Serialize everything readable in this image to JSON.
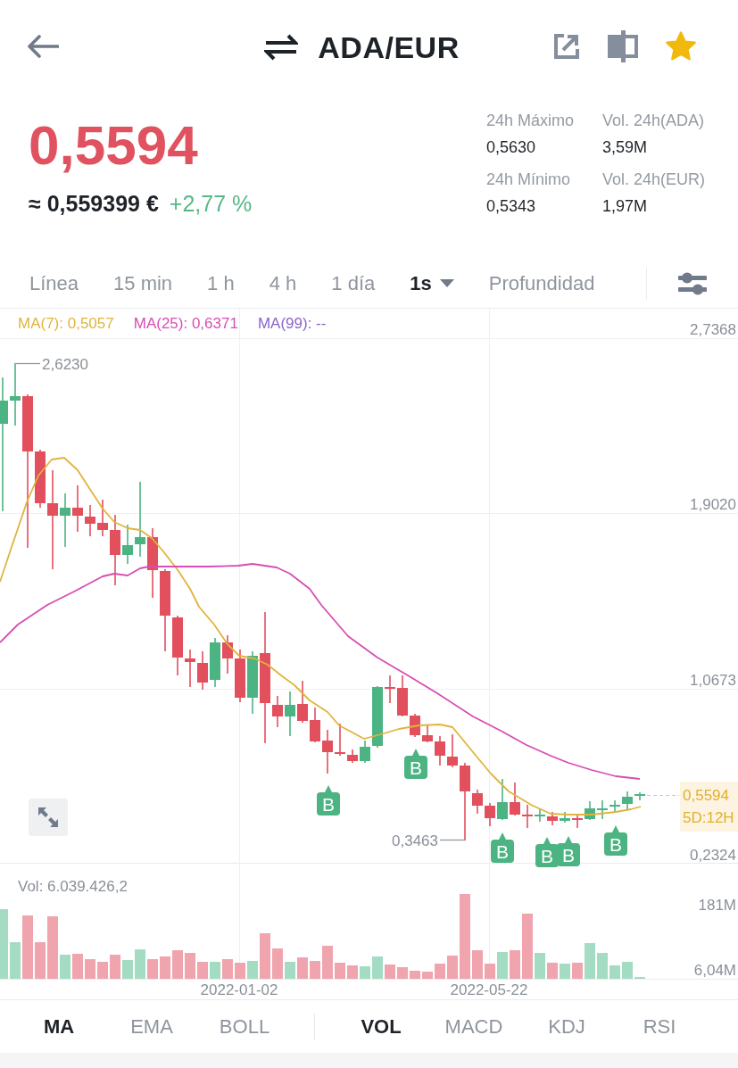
{
  "header": {
    "title": "ADA/EUR",
    "favorite": true
  },
  "price": {
    "value": "0,5594",
    "rising": false,
    "fiat": "≈ 0,559399 €",
    "change": "+2,77 %",
    "change_rising": true
  },
  "stats": [
    {
      "label": "24h Máximo",
      "value": "0,5630"
    },
    {
      "label": "Vol. 24h(ADA)",
      "value": "3,59M"
    },
    {
      "label": "24h Mínimo",
      "value": "0,5343"
    },
    {
      "label": "Vol. 24h(EUR)",
      "value": "1,97M"
    }
  ],
  "intervals": [
    {
      "label": "Línea",
      "kind": "option",
      "selected": false
    },
    {
      "label": "15 min",
      "kind": "option",
      "selected": false
    },
    {
      "label": "1 h",
      "kind": "option",
      "selected": false
    },
    {
      "label": "4 h",
      "kind": "option",
      "selected": false
    },
    {
      "label": "1 día",
      "kind": "option",
      "selected": false
    },
    {
      "label": "1s",
      "kind": "menu",
      "selected": true
    },
    {
      "label": "Profundidad",
      "kind": "option",
      "selected": false
    }
  ],
  "chart": {
    "legend": [
      {
        "label": "MA(7): 0,5057",
        "color": "#e0b43c"
      },
      {
        "label": "MA(25): 0,6371",
        "color": "#d84db3"
      },
      {
        "label": "MA(99): --",
        "color": "#8b63c9"
      }
    ],
    "y_labels": [
      "2,7368",
      "1,9020",
      "1,0673",
      "0,2324"
    ],
    "high_label": "2,6230",
    "low_label": "0,3463",
    "price_tag": {
      "price": "0,5594",
      "countdown": "5D:12H"
    },
    "markers": [
      {
        "label": "B"
      },
      {
        "label": "B"
      },
      {
        "label": "B"
      },
      {
        "label": "B"
      },
      {
        "label": "B"
      },
      {
        "label": "B"
      }
    ]
  },
  "volume": {
    "label": "Vol: 6.039.426,2",
    "y_labels": [
      "181M",
      "6,04M"
    ],
    "x_labels": [
      "2022-01-02",
      "2022-05-22"
    ]
  },
  "indicators": {
    "main": [
      {
        "label": "MA",
        "selected": true
      },
      {
        "label": "EMA",
        "selected": false
      },
      {
        "label": "BOLL",
        "selected": false
      }
    ],
    "sub": [
      {
        "label": "VOL",
        "selected": true
      },
      {
        "label": "MACD",
        "selected": false
      },
      {
        "label": "KDJ",
        "selected": false
      },
      {
        "label": "RSI",
        "selected": false
      }
    ]
  }
}
